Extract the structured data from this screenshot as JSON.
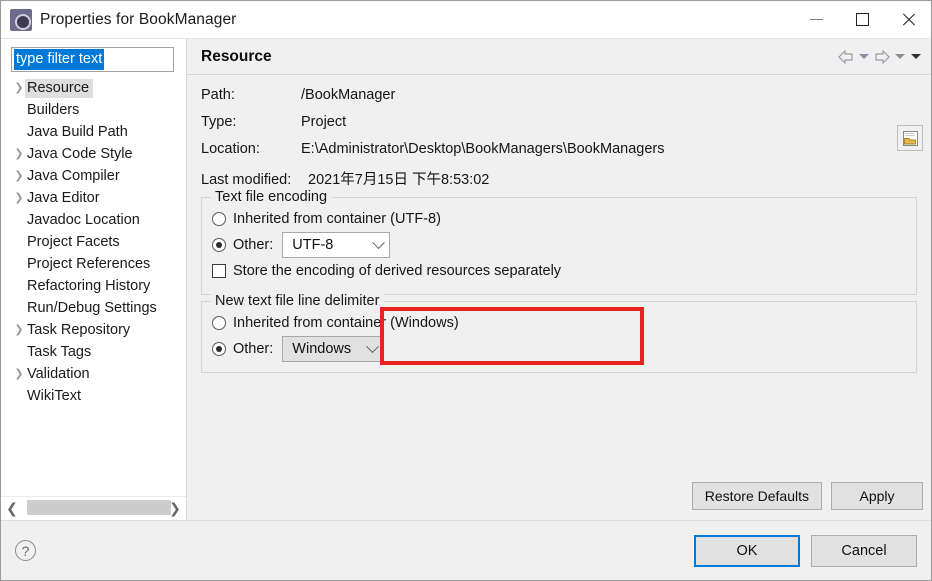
{
  "window": {
    "title": "Properties for BookManager",
    "icon": "eclipse-properties-icon",
    "minimize_label": "Minimize",
    "maximize_label": "Maximize",
    "close_label": "Close"
  },
  "sidebar": {
    "filter": {
      "value": "type filter text",
      "placeholder": "type filter text",
      "selected": true
    },
    "items": [
      {
        "label": "Resource",
        "expandable": true,
        "selected": true
      },
      {
        "label": "Builders",
        "expandable": false,
        "selected": false
      },
      {
        "label": "Java Build Path",
        "expandable": false,
        "selected": false
      },
      {
        "label": "Java Code Style",
        "expandable": true,
        "selected": false
      },
      {
        "label": "Java Compiler",
        "expandable": true,
        "selected": false
      },
      {
        "label": "Java Editor",
        "expandable": true,
        "selected": false
      },
      {
        "label": "Javadoc Location",
        "expandable": false,
        "selected": false
      },
      {
        "label": "Project Facets",
        "expandable": false,
        "selected": false
      },
      {
        "label": "Project References",
        "expandable": false,
        "selected": false
      },
      {
        "label": "Refactoring History",
        "expandable": false,
        "selected": false
      },
      {
        "label": "Run/Debug Settings",
        "expandable": false,
        "selected": false
      },
      {
        "label": "Task Repository",
        "expandable": true,
        "selected": false
      },
      {
        "label": "Task Tags",
        "expandable": false,
        "selected": false
      },
      {
        "label": "Validation",
        "expandable": true,
        "selected": false
      },
      {
        "label": "WikiText",
        "expandable": false,
        "selected": false
      }
    ],
    "scrollbar": {
      "left_arrow": "❮",
      "right_arrow": "❯"
    }
  },
  "page": {
    "title": "Resource",
    "nav": {
      "back_icon": "arrow-left-icon",
      "back_menu_icon": "chevron-down-icon",
      "forward_icon": "arrow-right-icon",
      "forward_menu_icon": "chevron-down-icon",
      "view_menu_icon": "chevron-down-icon"
    },
    "info": [
      {
        "label": "Path:",
        "value": "/BookManager"
      },
      {
        "label": "Type:",
        "value": "Project"
      },
      {
        "label": "Location:",
        "value": "E:\\Administrator\\Desktop\\BookManagers\\BookManagers"
      }
    ],
    "last_modified": {
      "label": "Last modified:",
      "value": "2021年7月15日 下午8:53:02"
    },
    "location_button_icon": "open-folder-icon",
    "encoding_group": {
      "title": "Text file encoding",
      "inherited": {
        "label": "Inherited from container (UTF-8)",
        "checked": false
      },
      "other": {
        "label": "Other:",
        "checked": true,
        "value": "UTF-8"
      },
      "store_derived": {
        "label": "Store the encoding of derived resources separately",
        "checked": false
      }
    },
    "delimiter_group": {
      "title": "New text file line delimiter",
      "inherited": {
        "label": "Inherited from container (Windows)",
        "checked": false
      },
      "other": {
        "label": "Other:",
        "checked": true,
        "value": "Windows"
      }
    },
    "restore_defaults_label": "Restore Defaults",
    "apply_label": "Apply"
  },
  "annotation": {
    "color": "#e8221d",
    "name": "encoding-highlight-box"
  },
  "footer": {
    "help_icon": "question-mark-icon",
    "ok_label": "OK",
    "cancel_label": "Cancel"
  }
}
